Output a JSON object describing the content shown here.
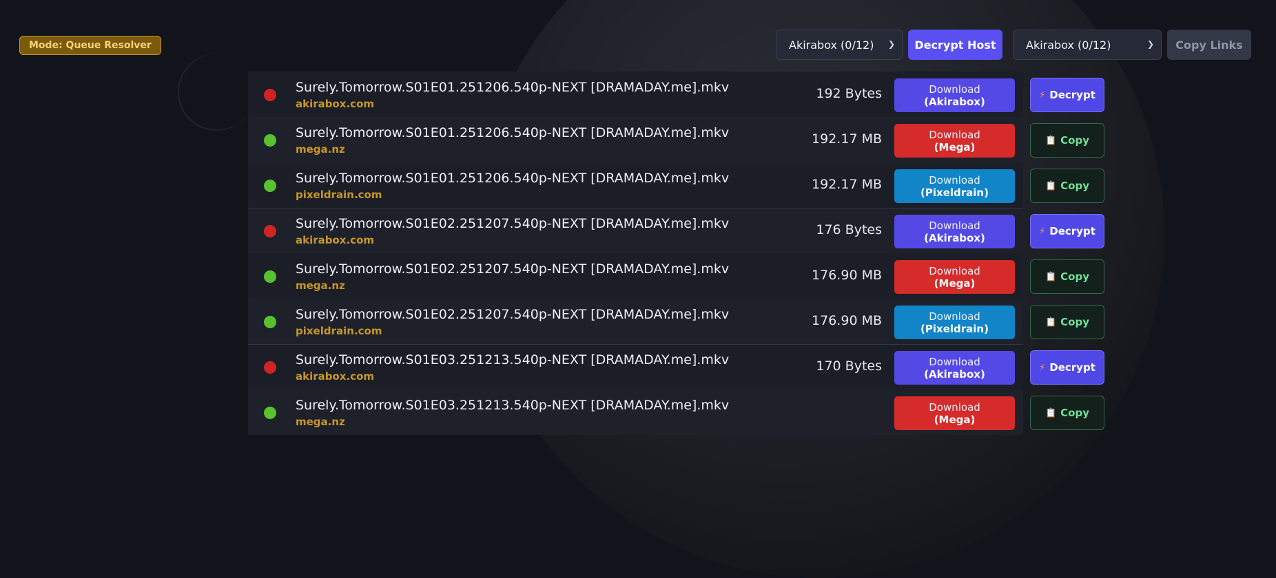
{
  "mode_badge": "Mode: Queue Resolver",
  "toolbar": {
    "left_select": "Akirabox (0/12)",
    "decrypt_host_label": "Decrypt Host",
    "right_select": "Akirabox (0/12)",
    "copy_links_label": "Copy Links"
  },
  "icons": {
    "decrypt": "bolt-icon",
    "copy": "clipboard-icon",
    "select": "chevron-down-icon"
  },
  "colors": {
    "status_offline": "#d02424",
    "status_online": "#57c22e",
    "akirabox": "#5549e6",
    "mega": "#d52b2b",
    "pixeldrain": "#1185c8",
    "accent": "#5a4ff0"
  },
  "rows": [
    {
      "status": "red",
      "filename": "Surely.Tomorrow.S01E01.251206.540p-NEXT [DRAMADAY.me].mkv",
      "host": "akirabox.com",
      "size": "192 Bytes",
      "dl_line1": "Download",
      "dl_line2": "(Akirabox)",
      "dl_type": "akirabox",
      "action": "Decrypt",
      "action_type": "decrypt"
    },
    {
      "status": "green",
      "filename": "Surely.Tomorrow.S01E01.251206.540p-NEXT [DRAMADAY.me].mkv",
      "host": "mega.nz",
      "size": "192.17 MB",
      "dl_line1": "Download",
      "dl_line2": "(Mega)",
      "dl_type": "mega",
      "action": "Copy",
      "action_type": "copy"
    },
    {
      "status": "green",
      "filename": "Surely.Tomorrow.S01E01.251206.540p-NEXT [DRAMADAY.me].mkv",
      "host": "pixeldrain.com",
      "size": "192.17 MB",
      "dl_line1": "Download",
      "dl_line2": "(Pixeldrain)",
      "dl_type": "pixeldrain",
      "action": "Copy",
      "action_type": "copy"
    },
    {
      "status": "red",
      "filename": "Surely.Tomorrow.S01E02.251207.540p-NEXT [DRAMADAY.me].mkv",
      "host": "akirabox.com",
      "size": "176 Bytes",
      "dl_line1": "Download",
      "dl_line2": "(Akirabox)",
      "dl_type": "akirabox",
      "action": "Decrypt",
      "action_type": "decrypt"
    },
    {
      "status": "green",
      "filename": "Surely.Tomorrow.S01E02.251207.540p-NEXT [DRAMADAY.me].mkv",
      "host": "mega.nz",
      "size": "176.90 MB",
      "dl_line1": "Download",
      "dl_line2": "(Mega)",
      "dl_type": "mega",
      "action": "Copy",
      "action_type": "copy"
    },
    {
      "status": "green",
      "filename": "Surely.Tomorrow.S01E02.251207.540p-NEXT [DRAMADAY.me].mkv",
      "host": "pixeldrain.com",
      "size": "176.90 MB",
      "dl_line1": "Download",
      "dl_line2": "(Pixeldrain)",
      "dl_type": "pixeldrain",
      "action": "Copy",
      "action_type": "copy"
    },
    {
      "status": "red",
      "filename": "Surely.Tomorrow.S01E03.251213.540p-NEXT [DRAMADAY.me].mkv",
      "host": "akirabox.com",
      "size": "170 Bytes",
      "dl_line1": "Download",
      "dl_line2": "(Akirabox)",
      "dl_type": "akirabox",
      "action": "Decrypt",
      "action_type": "decrypt"
    },
    {
      "status": "green",
      "filename": "Surely.Tomorrow.S01E03.251213.540p-NEXT [DRAMADAY.me].mkv",
      "host": "mega.nz",
      "size": "",
      "dl_line1": "Download",
      "dl_line2": "(Mega)",
      "dl_type": "mega",
      "action": "Copy",
      "action_type": "copy"
    }
  ]
}
